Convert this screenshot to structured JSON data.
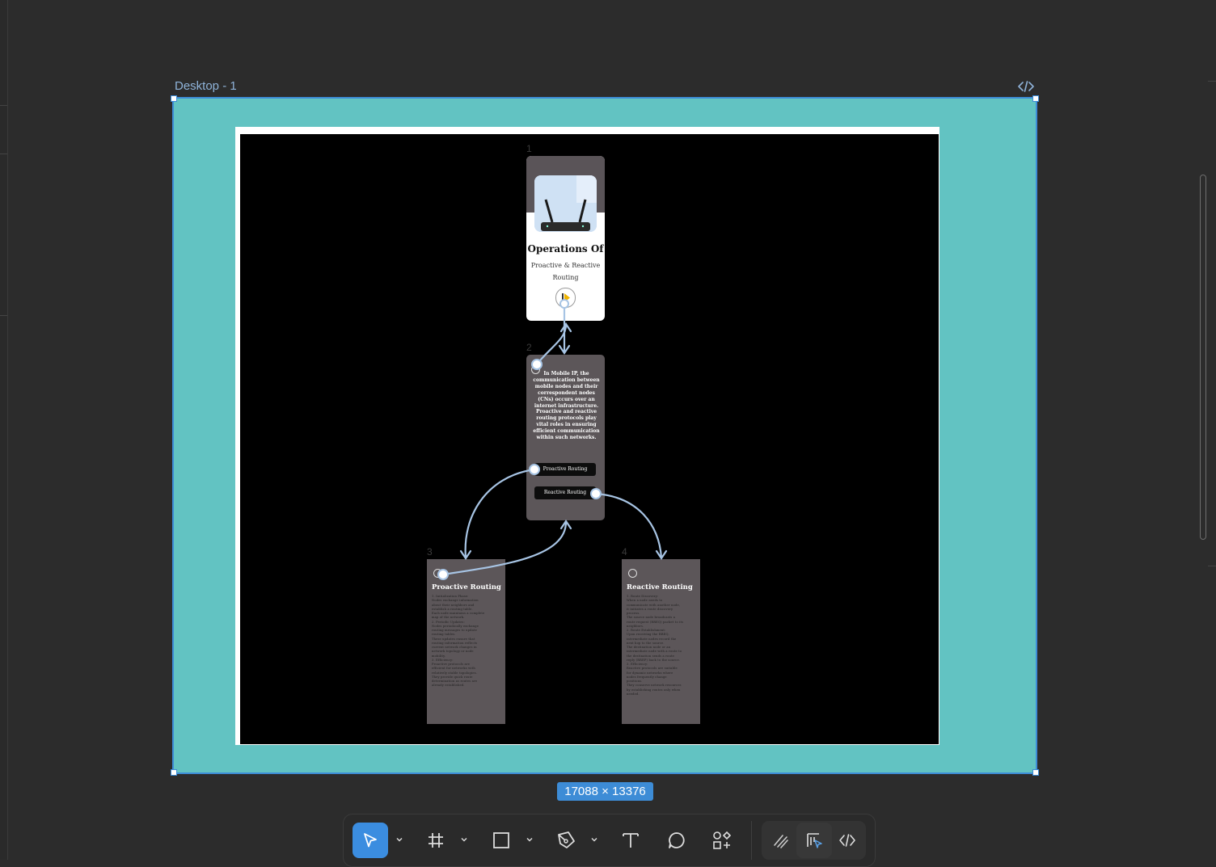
{
  "frame": {
    "label": "Desktop - 1",
    "dimensions": "17088 × 13376",
    "code_icon": "code-icon"
  },
  "board": {
    "screen_numbers": [
      "1",
      "2",
      "3",
      "4"
    ],
    "card1": {
      "title": "Operations Of",
      "subtitle": "Proactive & Reactive Routing",
      "image": "router-illustration",
      "play_icon": "play-icon"
    },
    "card2": {
      "body": "In Mobile IP, the communication between mobile nodes and their correspondent nodes (CNs) occurs over an internet infrastructure. Proactive and reactive routing protocols play vital roles in ensuring efficient communication within such networks.",
      "button_proactive": "Proactive Routing",
      "button_reactive": "Reactive Routing"
    },
    "card3": {
      "heading": "Proactive Routing",
      "body": "1. Initialization Phase:\n   Nodes exchange information\n   about their neighbors and\n   establish a routing table.\n   Each node maintains a complete\n   map of the network.\n2. Periodic Updates:\n   Nodes periodically exchange\n   routing messages to update\n   routing tables.\n   These updates ensure that\n   routing information reflects\n   current network changes in\n   network topology or node\n   mobility.\n3. Efficiency:\n   Proactive protocols are\n   efficient for networks with\n   relatively stable topologies.\n   They provide quick route\n   determination as routes are\n   already established."
    },
    "card4": {
      "heading": "Reactive Routing",
      "body": "1. Route Discovery:\n   When a node needs to\n   communicate with another node,\n   it initiates a route discovery\n   process.\n   The source node broadcasts a\n   route request (RREQ) packet to its\n   neighbors.\n2. Route Establishment:\n   Upon receiving the RREQ,\n   intermediate nodes record the\n   next hop to the source.\n   The destination node or an\n   intermediate node with a route to\n   the destination sends a route\n   reply (RREP) back to the source.\n3. Efficiency:\n   Reactive protocols are suitable\n   for dynamic networks where\n   nodes frequently change\n   positions.\n   They conserve network resources\n   by establishing routes only when\n   needed."
    }
  },
  "toolbar": {
    "tools": [
      "move-tool",
      "frame-tool",
      "rectangle-tool",
      "pen-tool",
      "text-tool",
      "comment-tool",
      "actions-tool"
    ],
    "modes": [
      "draw-mode",
      "design-mode",
      "dev-mode"
    ]
  },
  "colors": {
    "canvas": "#2c2c2c",
    "frame_fill": "#62c3c2",
    "selection": "#3d8cd6",
    "card_dark": "#5c5659",
    "wire": "#a7c4e4"
  }
}
